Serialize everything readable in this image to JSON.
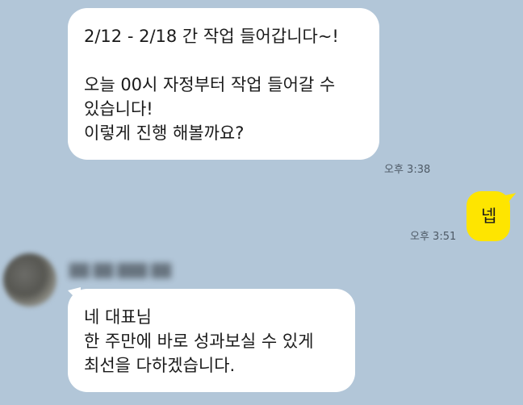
{
  "chat": {
    "messages": [
      {
        "side": "in",
        "text": "2/12 - 2/18 간 작업 들어갑니다~!\n\n오늘 00시 자정부터 작업 들어갈 수\n있습니다!\n이렇게 진행 해볼까요?",
        "time": "오후 3:38"
      },
      {
        "side": "out",
        "text": "넵",
        "time": "오후 3:51"
      },
      {
        "side": "in",
        "sender": "██ ██ ███ ██",
        "text": "네 대표님\n한 주만에 바로 성과보실 수 있게\n최선을 다하겠습니다.",
        "time": ""
      }
    ]
  },
  "colors": {
    "background": "#b2c6d8",
    "incoming_bubble": "#ffffff",
    "outgoing_bubble": "#fee500",
    "timestamp": "#4e5a66"
  }
}
